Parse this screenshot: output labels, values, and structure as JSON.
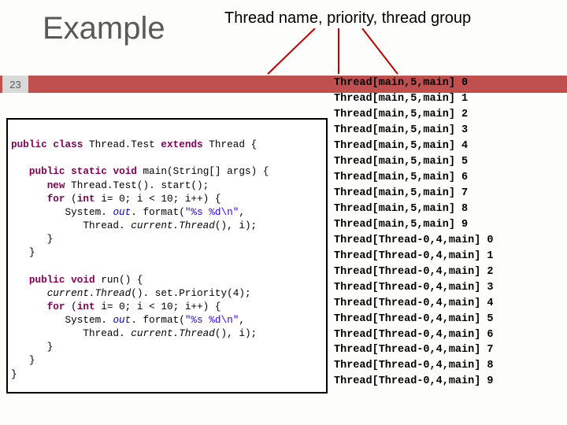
{
  "header": {
    "title": "Example",
    "subtitle": "Thread name, priority, thread group"
  },
  "page_number": "23",
  "code_lines": [
    {
      "t": "plain",
      "v": ""
    },
    {
      "t": "html",
      "v": "<span class='kw'>public</span> <span class='kw'>class</span> Thread.Test <span class='kw'>extends</span> Thread {"
    },
    {
      "t": "plain",
      "v": ""
    },
    {
      "t": "html",
      "v": "   <span class='kw'>public</span> <span class='kw'>static</span> <span class='kw'>void</span> main(String[] args) {"
    },
    {
      "t": "html",
      "v": "      <span class='kw'>new</span> Thread.Test(). start();"
    },
    {
      "t": "html",
      "v": "      <span class='kw'>for</span> (<span class='kw'>int</span> i= 0; i &lt; 10; i++) {"
    },
    {
      "t": "html",
      "v": "         System. <span class='itblue'>out</span>. format(<span class='str'>\"%s %d\\n\"</span>,"
    },
    {
      "t": "html",
      "v": "            Thread. <span class='it'>current.Thread</span>(), i);"
    },
    {
      "t": "plain",
      "v": "      }"
    },
    {
      "t": "plain",
      "v": "   }"
    },
    {
      "t": "plain",
      "v": ""
    },
    {
      "t": "html",
      "v": "   <span class='kw'>public</span> <span class='kw'>void</span> run() {"
    },
    {
      "t": "html",
      "v": "      <span class='it'>current.Thread</span>(). set.Priority(4);"
    },
    {
      "t": "html",
      "v": "      <span class='kw'>for</span> (<span class='kw'>int</span> i= 0; i &lt; 10; i++) {"
    },
    {
      "t": "html",
      "v": "         System. <span class='itblue'>out</span>. format(<span class='str'>\"%s %d\\n\"</span>,"
    },
    {
      "t": "html",
      "v": "            Thread. <span class='it'>current.Thread</span>(), i);"
    },
    {
      "t": "plain",
      "v": "      }"
    },
    {
      "t": "plain",
      "v": "   }"
    },
    {
      "t": "plain",
      "v": "}"
    }
  ],
  "output_lines": [
    "Thread[main,5,main] 0",
    "Thread[main,5,main] 1",
    "Thread[main,5,main] 2",
    "Thread[main,5,main] 3",
    "Thread[main,5,main] 4",
    "Thread[main,5,main] 5",
    "Thread[main,5,main] 6",
    "Thread[main,5,main] 7",
    "Thread[main,5,main] 8",
    "Thread[main,5,main] 9",
    "Thread[Thread-0,4,main] 0",
    "Thread[Thread-0,4,main] 1",
    "Thread[Thread-0,4,main] 2",
    "Thread[Thread-0,4,main] 3",
    "Thread[Thread-0,4,main] 4",
    "Thread[Thread-0,4,main] 5",
    "Thread[Thread-0,4,main] 6",
    "Thread[Thread-0,4,main] 7",
    "Thread[Thread-0,4,main] 8",
    "Thread[Thread-0,4,main] 9"
  ]
}
